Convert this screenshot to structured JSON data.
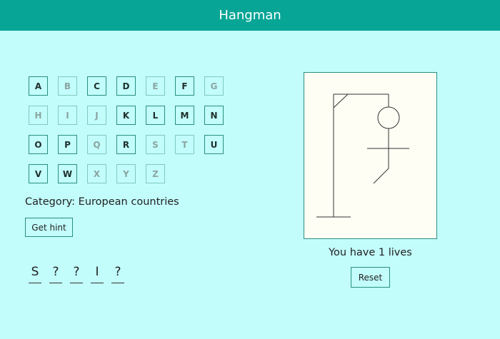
{
  "header": {
    "title": "Hangman"
  },
  "keyboard": {
    "letters": [
      "A",
      "B",
      "C",
      "D",
      "E",
      "F",
      "G",
      "H",
      "I",
      "J",
      "K",
      "L",
      "M",
      "N",
      "O",
      "P",
      "Q",
      "R",
      "S",
      "T",
      "U",
      "V",
      "W",
      "X",
      "Y",
      "Z"
    ],
    "used": [
      "B",
      "E",
      "G",
      "H",
      "I",
      "J",
      "Q",
      "S",
      "T",
      "X",
      "Y",
      "Z"
    ]
  },
  "category": {
    "text": "Category: European countries"
  },
  "hint_button": {
    "label": "Get hint"
  },
  "word": {
    "slots": [
      "S",
      "?",
      "?",
      "I",
      "?"
    ]
  },
  "status": {
    "lives_text": "You have 1 lives"
  },
  "reset_button": {
    "label": "Reset"
  },
  "gallows": {
    "wrong_guesses_drawn": [
      "base",
      "pole",
      "beam",
      "brace",
      "rope",
      "head",
      "body",
      "arms",
      "left-leg"
    ]
  },
  "colors": {
    "header_bg": "#07a595",
    "page_bg": "#c2fdfb",
    "board_bg": "#fffef4",
    "key_border": "#2a8f80",
    "used_key_border": "#82c8c0"
  }
}
